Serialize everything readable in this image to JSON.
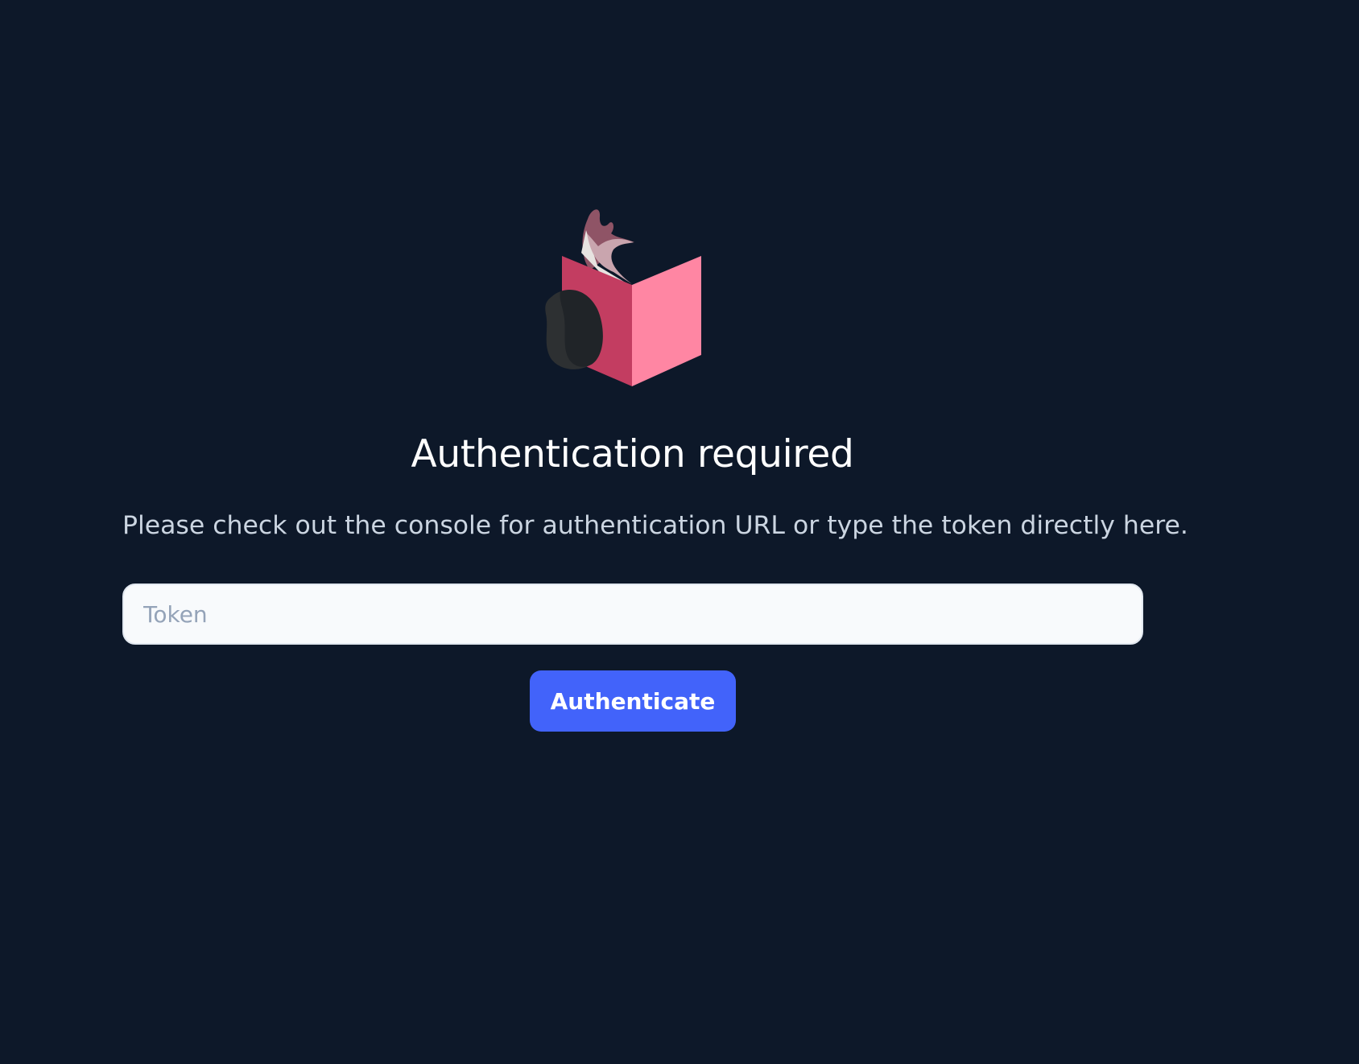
{
  "logo": {
    "icon": "reading-fox-book-icon",
    "colors": {
      "book_left": "#c33d61",
      "book_right": "#ff86a3",
      "fox_ear": "#8f5466",
      "fox_face": "#c9a5ae",
      "tail": "#202428"
    }
  },
  "auth": {
    "title": "Authentication required",
    "description": "Please check out the console for authentication URL or type the token directly here.",
    "token_placeholder": "Token",
    "token_value": "",
    "button_label": "Authenticate"
  },
  "colors": {
    "background": "#0d1829",
    "accent": "#4263fa",
    "title_text": "#ffffff",
    "description_text": "#cbd5e1",
    "input_background": "#f8fafc",
    "placeholder_text": "#94a3b8"
  }
}
